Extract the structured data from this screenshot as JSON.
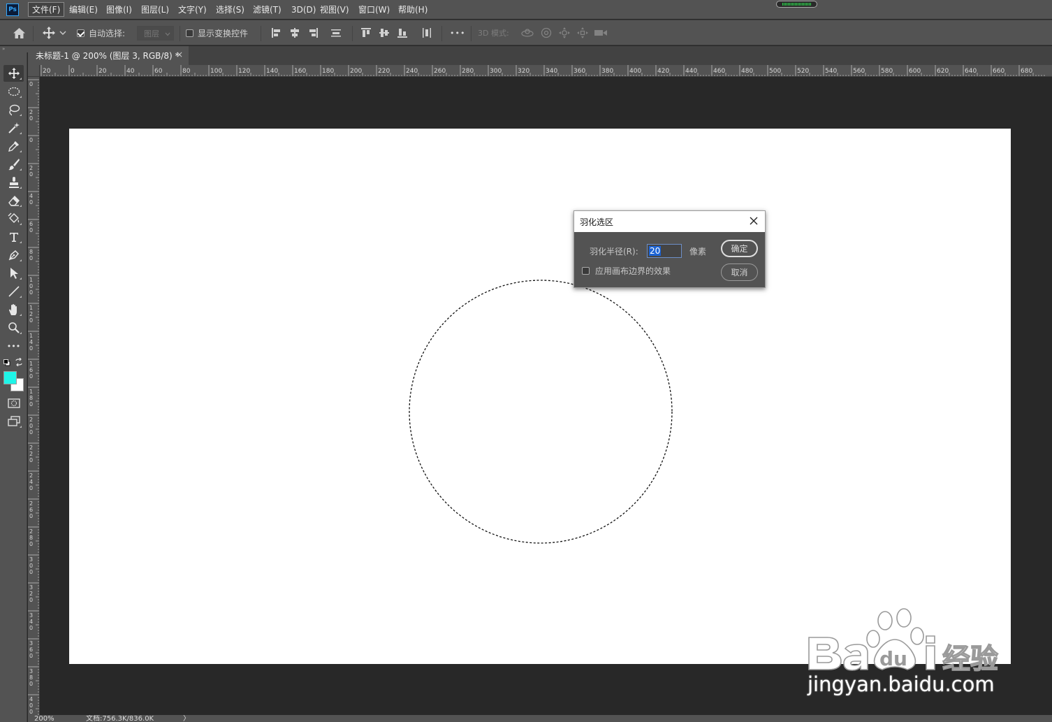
{
  "app": {
    "logo_text": "Ps",
    "menu": [
      "文件(F)",
      "编辑(E)",
      "图像(I)",
      "图层(L)",
      "文字(Y)",
      "选择(S)",
      "滤镜(T)",
      "3D(D)",
      "视图(V)",
      "窗口(W)",
      "帮助(H)"
    ],
    "active_menu_index": 0
  },
  "options": {
    "auto_select_label": "自动选择:",
    "auto_select_checked": true,
    "layer_select_value": "图层",
    "show_transform_label": "显示变换控件",
    "show_transform_checked": false,
    "mode_3d_label": "3D 模式:",
    "more_glyph": "•••"
  },
  "document": {
    "tab_title": "未标题-1 @ 200% (图层 3, RGB/8) *",
    "tab_close": "×"
  },
  "rulers": {
    "top_labels": [
      "20",
      "0",
      "20",
      "40",
      "60",
      "80",
      "100",
      "120",
      "140",
      "160",
      "180",
      "200",
      "220",
      "240",
      "260",
      "280",
      "300",
      "320",
      "340",
      "360",
      "380",
      "400",
      "420",
      "440",
      "460",
      "480",
      "500",
      "520",
      "540",
      "560",
      "580",
      "600",
      "620",
      "640",
      "660",
      "680"
    ],
    "left_labels": [
      "0",
      "20",
      "0",
      "20",
      "40",
      "60",
      "80",
      "100",
      "120",
      "140",
      "160",
      "180",
      "200",
      "220",
      "240",
      "260",
      "280",
      "300",
      "320",
      "340",
      "360",
      "380",
      "400"
    ]
  },
  "colors": {
    "foreground": "#1ef5e8",
    "background": "#ffffff",
    "ui_panel": "#535353",
    "workspace": "#282828"
  },
  "dialog": {
    "title": "羽化选区",
    "radius_label": "羽化半径(R):",
    "radius_value": "20",
    "unit": "像素",
    "ok_label": "确定",
    "cancel_label": "取消",
    "apply_canvas_label": "应用画布边界的效果",
    "apply_canvas_checked": false
  },
  "status": {
    "zoom": "200%",
    "doc_size": "文档:756.3K/836.0K",
    "arrow": "〉"
  },
  "watermark": {
    "url": "jingyan.baidu.com"
  }
}
